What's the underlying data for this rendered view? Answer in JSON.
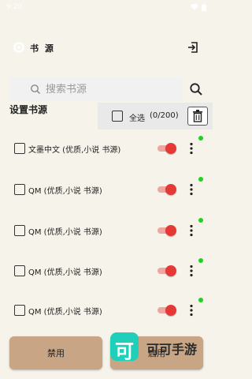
{
  "status_bar": {
    "time": "9:29"
  },
  "header": {
    "title": "书 源"
  },
  "search": {
    "placeholder": "搜索书源",
    "value": ""
  },
  "section": {
    "title": "设置书源"
  },
  "select_all": {
    "label": "全选",
    "count": "(0/200)"
  },
  "sources": [
    {
      "name": "文墨中文 (优质,小说 书源)",
      "enabled": true,
      "status": "green"
    },
    {
      "name": "QM (优质,小说 书源)",
      "enabled": true,
      "status": "green"
    },
    {
      "name": "QM (优质,小说 书源)",
      "enabled": true,
      "status": "green"
    },
    {
      "name": "QM (优质,小说 书源)",
      "enabled": true,
      "status": "green"
    },
    {
      "name": "QM (优质,小说 书源)",
      "enabled": true,
      "status": "green"
    }
  ],
  "buttons": {
    "disable": "禁用",
    "enable": "启用"
  },
  "watermark": {
    "logo_char": "可",
    "text": "可可手游"
  },
  "colors": {
    "background": "#f6f3ea",
    "toggle_on": "#e53935",
    "status_dot": "#1ed31e",
    "button_bg": "#c8a585",
    "watermark": "#1fcfb9"
  },
  "icons": {
    "header_left": "gear-icon",
    "header_right": "exit-icon",
    "search": "search-icon",
    "delete": "trash-icon",
    "row_menu": "more-vertical-icon"
  }
}
